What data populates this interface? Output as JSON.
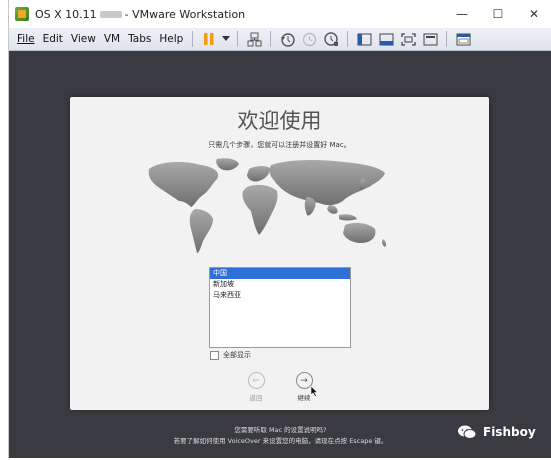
{
  "window": {
    "title_prefix": "OS X 10.11",
    "title_suffix": "- VMware Workstation",
    "controls": {
      "minimize": "—",
      "maximize": "☐",
      "close": "✕"
    }
  },
  "menu": {
    "items": [
      "File",
      "Edit",
      "View",
      "VM",
      "Tabs",
      "Help"
    ]
  },
  "welcome": {
    "title": "欢迎使用",
    "subtitle": "只需几个步骤，您就可以注册并设置好 Mac。",
    "countries": [
      "中国",
      "新加坡",
      "马来西亚"
    ],
    "show_all": "全部显示",
    "back_label": "返回",
    "continue_label": "继续"
  },
  "footer": {
    "line1": "您需要听取 Mac 的设置说明吗?",
    "line2": "若要了解如何使用 VoiceOver 来设置您的电脑，请现在点按 Escape 键。"
  },
  "watermark": {
    "text": "Fishboy"
  },
  "colors": {
    "vm_background": "#3a3b40",
    "selection": "#2f6fd8"
  }
}
